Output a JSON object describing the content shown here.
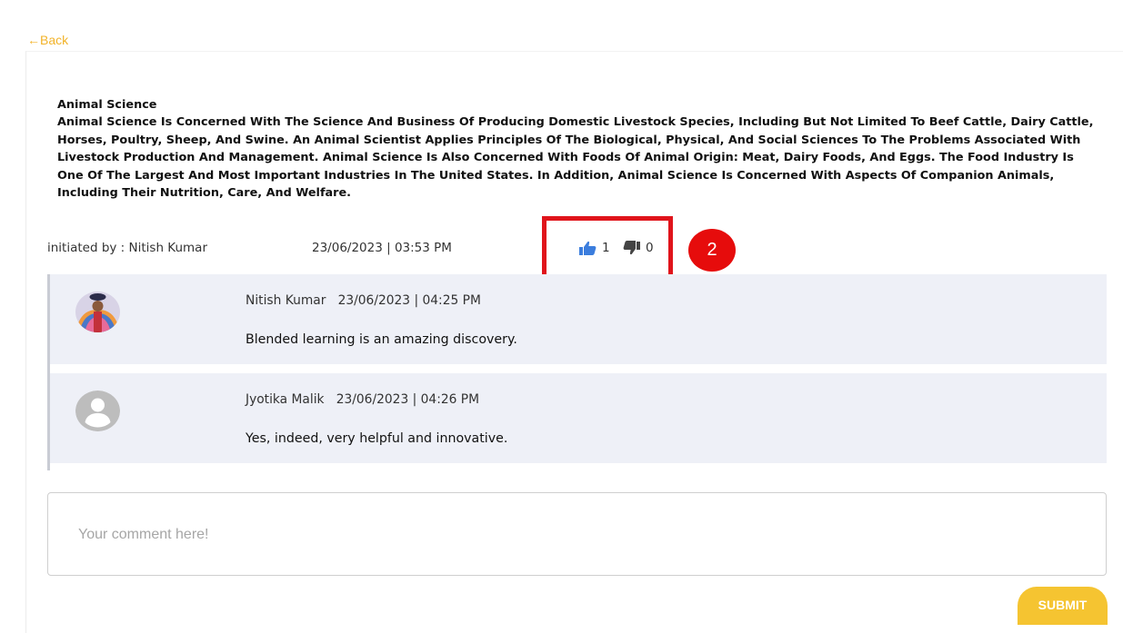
{
  "nav": {
    "back_label": "←Back"
  },
  "post": {
    "title": "Animal Science",
    "body": "Animal Science Is Concerned With The Science And Business Of Producing Domestic Livestock Species, Including But Not Limited To Beef Cattle, Dairy Cattle, Horses, Poultry, Sheep, And Swine. An Animal Scientist Applies Principles Of The Biological, Physical, And Social Sciences To The Problems Associated With Livestock Production And Management. Animal Science Is Also Concerned With Foods Of Animal Origin: Meat, Dairy Foods, And Eggs. The Food Industry Is One Of The Largest And Most Important Industries In The United States. In Addition, Animal Science Is Concerned With Aspects Of Companion Animals, Including Their Nutrition, Care, And Welfare.",
    "initiated_by": "initiated by : Nitish Kumar",
    "datetime": "23/06/2023 | 03:53 PM",
    "likes": "1",
    "dislikes": "0",
    "like_icon": "thumbs-up-icon",
    "dislike_icon": "thumbs-down-icon",
    "like_color": "#3b7ddd",
    "dislike_color": "#444444"
  },
  "annotation": {
    "badge": "2",
    "color": "#e60c0c"
  },
  "comments": [
    {
      "author": "Nitish Kumar",
      "datetime": "23/06/2023 | 04:25 PM",
      "text": "Blended learning is an amazing discovery.",
      "avatar": "user-photo"
    },
    {
      "author": "Jyotika Malik",
      "datetime": "23/06/2023 | 04:26 PM",
      "text": "Yes, indeed, very helpful and innovative.",
      "avatar": "default-user-icon"
    }
  ],
  "compose": {
    "placeholder": "Your comment here!",
    "value": "",
    "submit_label": "SUBMIT",
    "accent": "#f5c431"
  }
}
